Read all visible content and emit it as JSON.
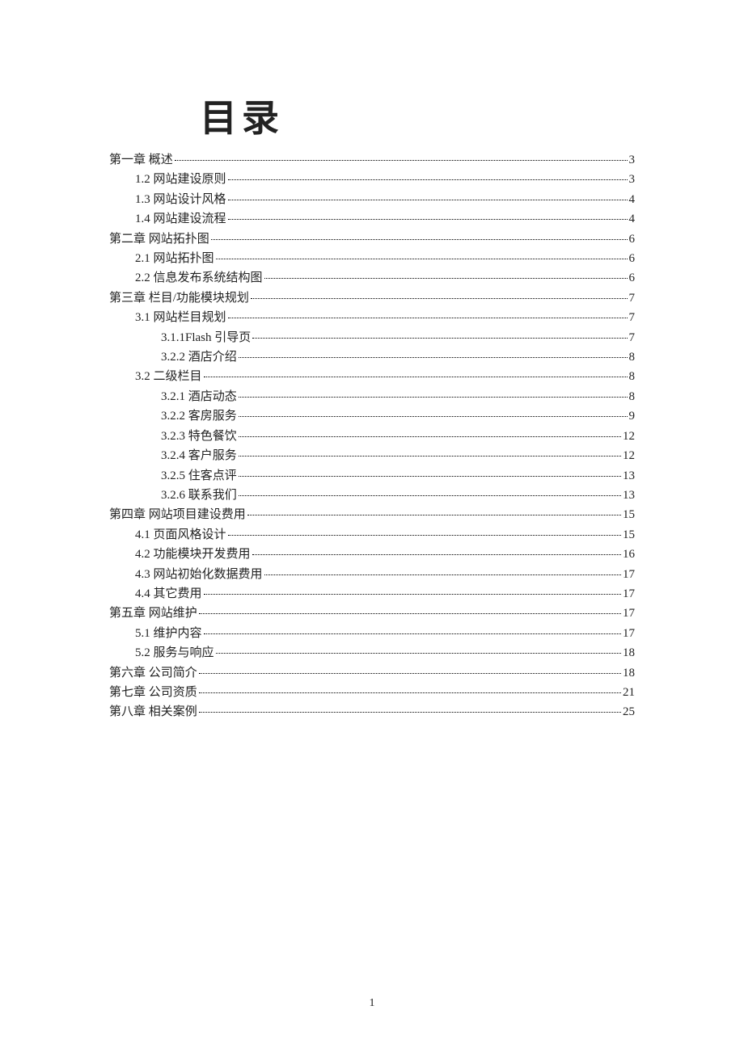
{
  "title": "目录",
  "page_number": "1",
  "toc": [
    {
      "level": 0,
      "label": "第一章  概述",
      "page": "3"
    },
    {
      "level": 1,
      "label": "1.2 网站建设原则",
      "page": "3"
    },
    {
      "level": 1,
      "label": "1.3 网站设计风格",
      "page": "4"
    },
    {
      "level": 1,
      "label": "1.4 网站建设流程",
      "page": "4"
    },
    {
      "level": 0,
      "label": "第二章  网站拓扑图",
      "page": "6"
    },
    {
      "level": 1,
      "label": "2.1 网站拓扑图",
      "page": "6"
    },
    {
      "level": 1,
      "label": "2.2 信息发布系统结构图",
      "page": "6"
    },
    {
      "level": 0,
      "label": "第三章  栏目/功能模块规划",
      "page": "7"
    },
    {
      "level": 1,
      "label": "3.1 网站栏目规划",
      "page": "7"
    },
    {
      "level": 2,
      "label": "3.1.1Flash 引导页",
      "page": "7"
    },
    {
      "level": 2,
      "label": "3.2.2 酒店介绍",
      "page": "8"
    },
    {
      "level": 1,
      "label": "3.2 二级栏目",
      "page": "8"
    },
    {
      "level": 2,
      "label": "3.2.1 酒店动态",
      "page": "8"
    },
    {
      "level": 2,
      "label": "3.2.2 客房服务",
      "page": "9"
    },
    {
      "level": 2,
      "label": "3.2.3 特色餐饮",
      "page": "12"
    },
    {
      "level": 2,
      "label": "3.2.4 客户服务",
      "page": "12"
    },
    {
      "level": 2,
      "label": "3.2.5 住客点评",
      "page": "13"
    },
    {
      "level": 2,
      "label": "3.2.6 联系我们",
      "page": "13"
    },
    {
      "level": 0,
      "label": "第四章  网站项目建设费用",
      "page": "15"
    },
    {
      "level": 1,
      "label": "4.1 页面风格设计",
      "page": "15"
    },
    {
      "level": 1,
      "label": "4.2 功能模块开发费用",
      "page": "16"
    },
    {
      "level": 1,
      "label": "4.3 网站初始化数据费用",
      "page": "17"
    },
    {
      "level": 1,
      "label": "4.4 其它费用",
      "page": "17"
    },
    {
      "level": 0,
      "label": "第五章  网站维护",
      "page": "17"
    },
    {
      "level": 1,
      "label": "5.1 维护内容",
      "page": "17"
    },
    {
      "level": 1,
      "label": "5.2 服务与响应",
      "page": "18"
    },
    {
      "level": 0,
      "label": "第六章  公司简介",
      "page": "18"
    },
    {
      "level": 0,
      "label": "第七章  公司资质",
      "page": "21"
    },
    {
      "level": 0,
      "label": "第八章  相关案例",
      "page": "25"
    }
  ]
}
